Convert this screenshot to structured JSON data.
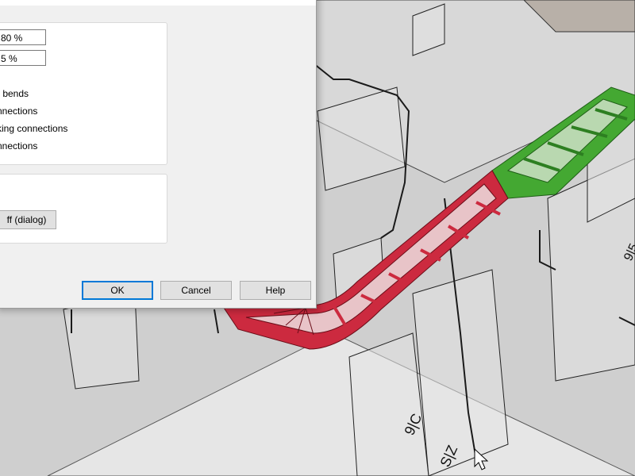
{
  "dialog": {
    "title": "",
    "fields": [
      {
        "value": "80 %"
      },
      {
        "value": "5 %"
      }
    ],
    "options": [
      {
        "label": "r bends"
      },
      {
        "label": "nnections"
      },
      {
        "label": "king connections"
      },
      {
        "label": "nnections"
      }
    ],
    "dialog_button_label": "ff (dialog)",
    "buttons": {
      "ok": "OK",
      "cancel": "Cancel",
      "help": "Help"
    }
  },
  "viewport": {
    "labels": [
      "9|C",
      "S|Z",
      "9|5"
    ],
    "colors": {
      "background": "#cfcfcf",
      "selected_tray": "#cc2a3f",
      "highlight_tray": "#44a832",
      "wireframe": "#202020"
    }
  }
}
